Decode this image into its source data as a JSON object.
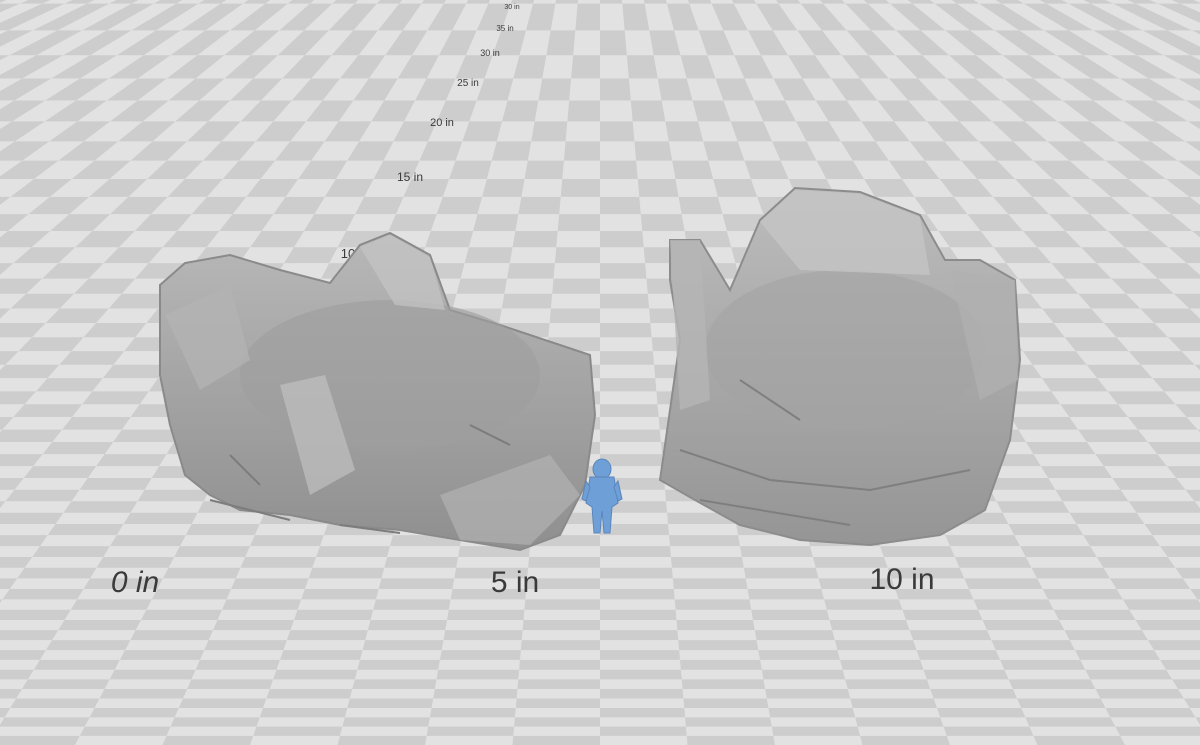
{
  "scale_labels": {
    "axis": [
      "30 in",
      "35 in",
      "30 in",
      "25 in",
      "20 in",
      "15 in",
      "10"
    ],
    "front": [
      "0 in",
      "5 in",
      "10 in"
    ]
  },
  "colors": {
    "floor_light": "#e2e2e2",
    "floor_dark": "#cdcdcd",
    "model_gray": "#a9a9a9",
    "figure_blue": "#6e9fd6"
  },
  "icons": {
    "left_model": "ruined-tower-model",
    "right_model": "ruined-tower-model",
    "figure": "miniature-figure"
  }
}
